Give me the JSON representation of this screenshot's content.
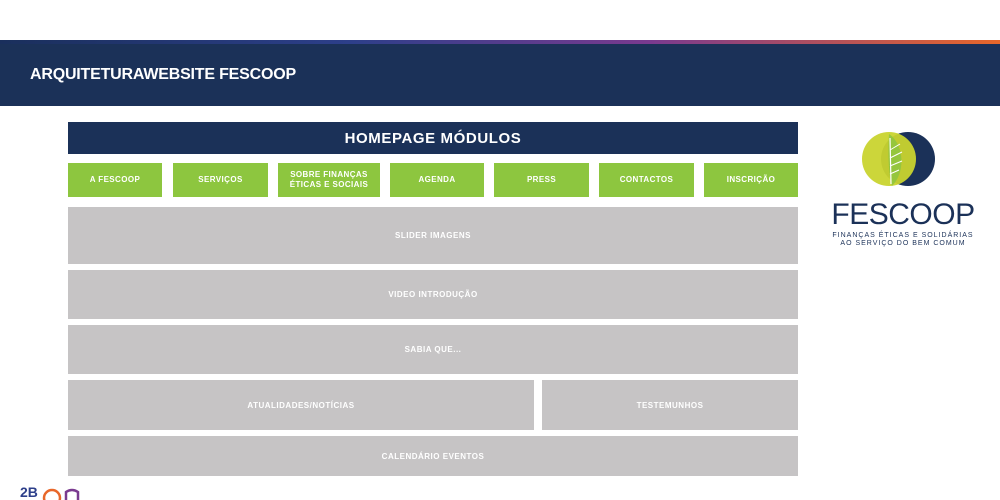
{
  "header": {
    "title": "ARQUITETURAWEBSITE FESCOOP"
  },
  "module": {
    "title": "HOMEPAGE MÓDULOS"
  },
  "nav": [
    {
      "label": "A FESCOOP"
    },
    {
      "label": "SERVIÇOS"
    },
    {
      "label": "SOBRE FINANÇAS ÉTICAS E SOCIAIS"
    },
    {
      "label": "AGENDA"
    },
    {
      "label": "PRESS"
    },
    {
      "label": "CONTACTOS"
    },
    {
      "label": "INSCRIÇÃO"
    }
  ],
  "blocks": {
    "slider": "SLIDER IMAGENS",
    "video": "VIDEO INTRODUÇÃO",
    "sabia": "SABIA QUE...",
    "atualidades": "ATUALIDADES/NOTÍCIAS",
    "testemunhos": "TESTEMUNHOS",
    "calendario": "CALENDÁRIO EVENTOS"
  },
  "logo": {
    "wordmark": "FESCOOP",
    "tagline_line1": "FINANÇAS ÉTICAS E SOLIDÁRIAS",
    "tagline_line2": "AO SERVIÇO DO BEM COMUM"
  },
  "corner_logo": {
    "text": "2B"
  },
  "colors": {
    "navy": "#1b3158",
    "green": "#8dc63f",
    "gray_block": "#c6c4c5",
    "lime": "#c9d42f"
  }
}
